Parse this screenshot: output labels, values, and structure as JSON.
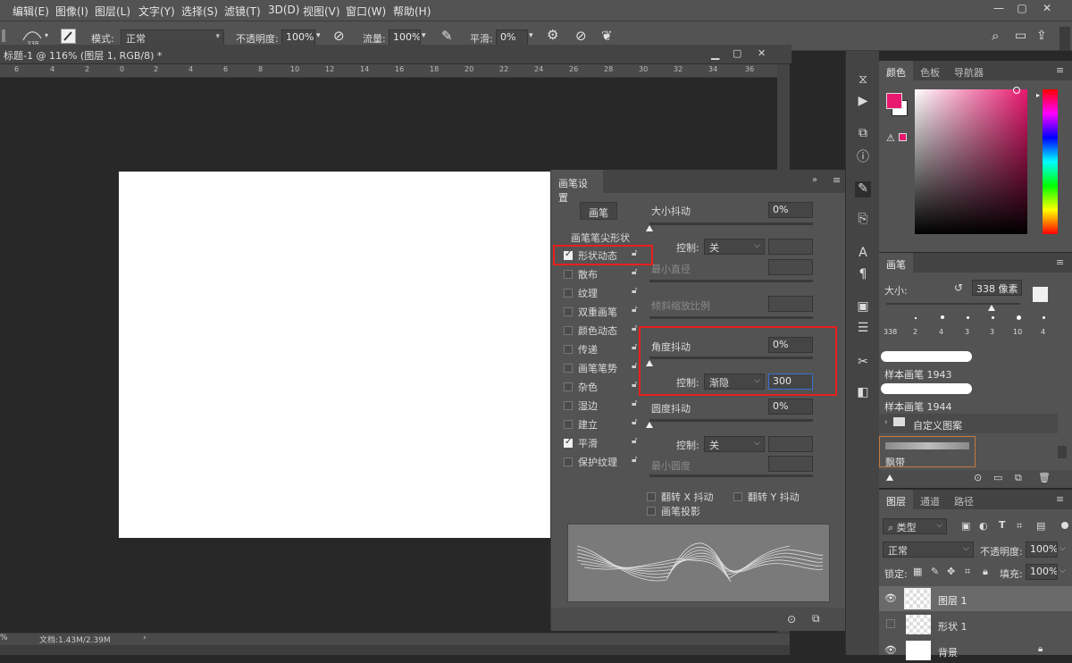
{
  "menu": [
    "编辑(E)",
    "图像(I)",
    "图层(L)",
    "文字(Y)",
    "选择(S)",
    "滤镜(T)",
    "3D(D)",
    "视图(V)",
    "窗口(W)",
    "帮助(H)"
  ],
  "options": {
    "brush_size": "338",
    "mode_label": "模式:",
    "mode_value": "正常",
    "opacity_label": "不透明度:",
    "opacity_value": "100%",
    "flow_label": "流量:",
    "flow_value": "100%",
    "smooth_label": "平滑:",
    "smooth_value": "0%"
  },
  "document": {
    "title": "标题-1 @ 116% (图层 1, RGB/8) *",
    "ruler_ticks": [
      "6",
      "4",
      "2",
      "0",
      "2",
      "4",
      "6",
      "8",
      "10",
      "12",
      "14",
      "16",
      "18",
      "20",
      "22",
      "24",
      "26",
      "28",
      "30",
      "32",
      "34",
      "36"
    ],
    "status": "文档:1.43M/2.39M",
    "zoom": "%"
  },
  "brush_settings": {
    "tab": "画笔设置",
    "brush_button": "画笔",
    "tip_shape": "画笔笔尖形状",
    "items": [
      {
        "label": "形状动态",
        "checked": true
      },
      {
        "label": "散布",
        "checked": false
      },
      {
        "label": "纹理",
        "checked": false
      },
      {
        "label": "双重画笔",
        "checked": false
      },
      {
        "label": "颜色动态",
        "checked": false
      },
      {
        "label": "传递",
        "checked": false
      },
      {
        "label": "画笔笔势",
        "checked": false
      },
      {
        "label": "杂色",
        "checked": false
      },
      {
        "label": "湿边",
        "checked": false
      },
      {
        "label": "建立",
        "checked": false
      },
      {
        "label": "平滑",
        "checked": true
      },
      {
        "label": "保护纹理",
        "checked": false
      }
    ],
    "size_jitter_label": "大小抖动",
    "size_jitter_value": "0%",
    "control_label": "控制:",
    "control_off": "关",
    "min_diameter_label": "最小直径",
    "tilt_scale_label": "倾斜缩放比例",
    "angle_jitter_label": "角度抖动",
    "angle_jitter_value": "0%",
    "angle_control_value": "渐隐",
    "angle_fade_value": "300",
    "roundness_jitter_label": "圆度抖动",
    "roundness_jitter_value": "0%",
    "roundness_control_value": "关",
    "min_roundness_label": "最小圆度",
    "flip_x_label": "翻转 X 抖动",
    "flip_y_label": "翻转 Y 抖动",
    "projection_label": "画笔投影"
  },
  "color_panel": {
    "tabs": [
      "颜色",
      "色板",
      "导航器"
    ],
    "foreground": "#e8186e",
    "hue_colors": [
      "#ff0000",
      "#ffff00",
      "#00ff00",
      "#00ffff",
      "#0000ff",
      "#ff00ff",
      "#ff0000"
    ]
  },
  "brushes_panel": {
    "tab": "画笔",
    "size_label": "大小:",
    "size_value": "338 像素",
    "presets": [
      "338",
      "2",
      "4",
      "3",
      "3",
      "10",
      "4"
    ],
    "preset_1943": "样本画笔 1943",
    "preset_1944": "样本画笔 1944",
    "group": "自定义图案",
    "ribbon": "飘带"
  },
  "layers_panel": {
    "tabs": [
      "图层",
      "通道",
      "路径"
    ],
    "filter": "类型",
    "blend": "正常",
    "opacity_label": "不透明度:",
    "opacity_value": "100%",
    "lock_label": "锁定:",
    "fill_label": "填充:",
    "fill_value": "100%",
    "layers": [
      "图层 1",
      "形状 1",
      "背景"
    ]
  }
}
